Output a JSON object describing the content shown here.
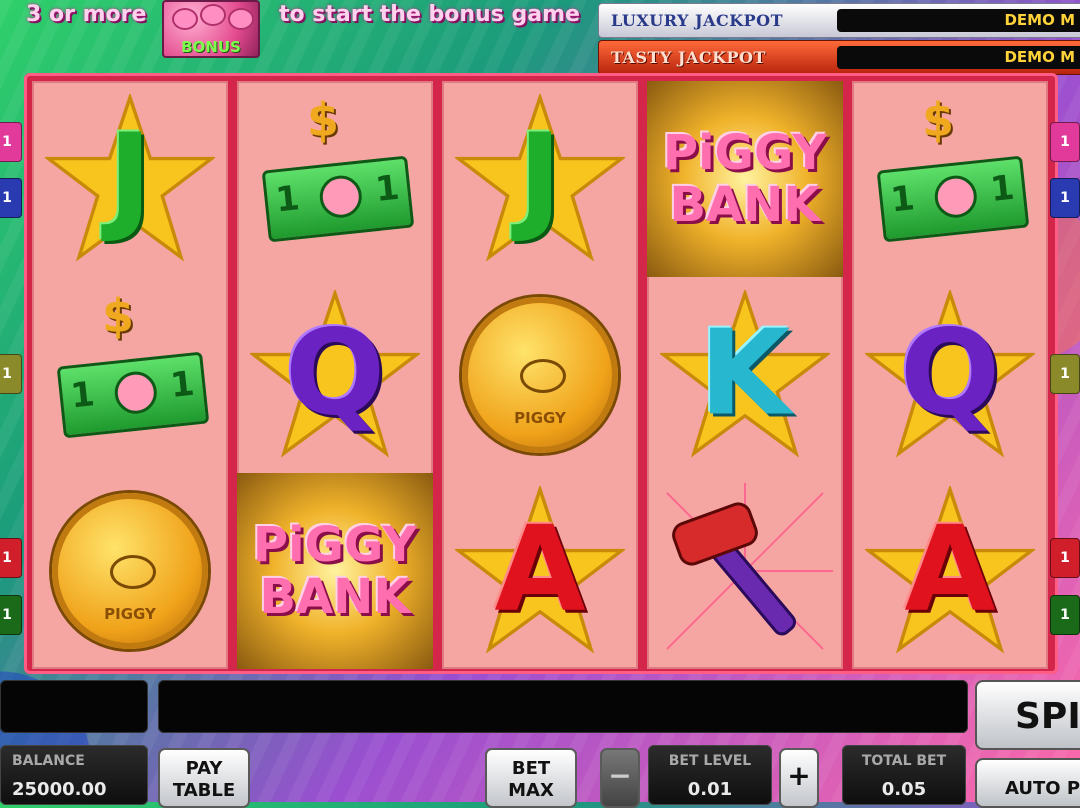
{
  "banner": {
    "text_left": "3 or more",
    "bonus_icon_label": "BONUS",
    "text_right": "to start the bonus game"
  },
  "jackpots": [
    {
      "name": "LUXURY JACKPOT",
      "value": "DEMO M"
    },
    {
      "name": "TASTY JACKPOT",
      "value": "DEMO M"
    }
  ],
  "reels": [
    [
      "letter-J",
      "cash-note",
      "piggy-coin"
    ],
    [
      "cash-note",
      "letter-Q",
      "piggy-bank-logo"
    ],
    [
      "letter-J",
      "piggy-coin",
      "letter-A"
    ],
    [
      "piggy-bank-logo",
      "letter-K",
      "hammer"
    ],
    [
      "cash-note",
      "letter-Q",
      "letter-A"
    ]
  ],
  "symbols": {
    "letter_J": "J",
    "letter_Q": "Q",
    "letter_K": "K",
    "letter_A": "A",
    "cash_digit": "1",
    "dollar": "$",
    "coin_word": "PIGGY",
    "logo_line1": "PiGGY",
    "logo_line2": "BANK"
  },
  "line_markers": {
    "left": [
      {
        "label": "1",
        "color": "#e23a9a"
      },
      {
        "label": "1",
        "color": "#2a3ab0"
      },
      {
        "label": "1",
        "color": "#8a8a2a"
      },
      {
        "label": "1",
        "color": "#d01e2a"
      },
      {
        "label": "1",
        "color": "#1a6a1a"
      }
    ],
    "right": [
      {
        "label": "1",
        "color": "#e23a9a"
      },
      {
        "label": "1",
        "color": "#2a3ab0"
      },
      {
        "label": "1",
        "color": "#8a8a2a"
      },
      {
        "label": "1",
        "color": "#d01e2a"
      },
      {
        "label": "1",
        "color": "#1a6a1a"
      }
    ]
  },
  "controls": {
    "spin_label": "SPI",
    "autoplay_label": "AUTO PL",
    "balance_label": "BALANCE",
    "balance_value": "25000.00",
    "paytable_line1": "PAY",
    "paytable_line2": "TABLE",
    "betmax_line1": "BET",
    "betmax_line2": "MAX",
    "minus_label": "−",
    "plus_label": "+",
    "bet_level_label": "BET LEVEL",
    "bet_level_value": "0.01",
    "total_bet_label": "TOTAL BET",
    "total_bet_value": "0.05"
  },
  "colors": {
    "reel_frame": "#d4264a",
    "reel_bg": "#f6a6a2",
    "jackpot_value": "#ffd23a"
  }
}
